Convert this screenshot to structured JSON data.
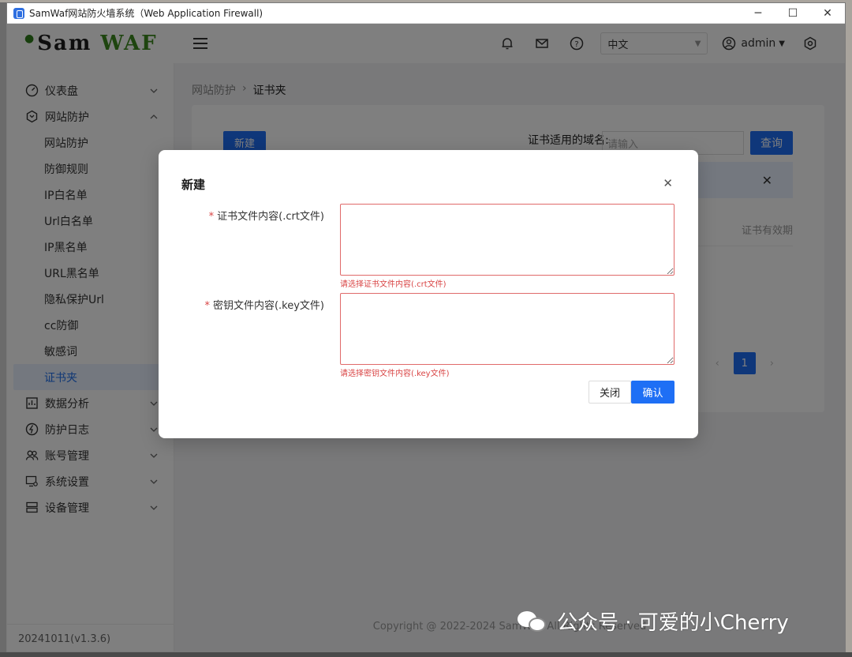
{
  "window": {
    "title": "SamWaf网站防火墙系统（Web Application Firewall)"
  },
  "header": {
    "logo": "Sam",
    "logo_accent": "WAF",
    "language": "中文",
    "user": "admin"
  },
  "sidebar": {
    "items": [
      {
        "label": "仪表盘",
        "icon": "dashboard-icon"
      },
      {
        "label": "网站防护",
        "icon": "shield-icon"
      }
    ],
    "subitems": [
      "网站防护",
      "防御规则",
      "IP白名单",
      "Url白名单",
      "IP黑名单",
      "URL黑名单",
      "隐私保护Url",
      "cc防御",
      "敏感词",
      "证书夹"
    ],
    "groups": [
      {
        "label": "数据分析",
        "icon": "chart-icon"
      },
      {
        "label": "防护日志",
        "icon": "bolt-icon"
      },
      {
        "label": "账号管理",
        "icon": "users-icon"
      },
      {
        "label": "系统设置",
        "icon": "monitor-settings-icon"
      },
      {
        "label": "设备管理",
        "icon": "server-icon"
      }
    ],
    "version": "20241011(v1.3.6)"
  },
  "main": {
    "breadcrumb": [
      "网站防护",
      "证书夹"
    ],
    "new_button": "新建",
    "filter_label": "证书适用的域名:",
    "filter_placeholder": "请输入",
    "query_button": "查询",
    "column_header": "证书有效期",
    "page": "1",
    "copyright": "Copyright @ 2022-2024 SamWaf. All Rights Reserved"
  },
  "modal": {
    "title": "新建",
    "crt_label": "证书文件内容(.crt文件)",
    "crt_error": "请选择证书文件内容(.crt文件)",
    "key_label": "密钥文件内容(.key文件)",
    "key_error": "请选择密钥文件内容(.key文件)",
    "cancel": "关闭",
    "confirm": "确认"
  },
  "watermark": "公众号 · 可爱的小Cherry",
  "colors": {
    "primary": "#1e6ff5",
    "error": "#d94545",
    "brand_green": "#3d8a1e"
  }
}
